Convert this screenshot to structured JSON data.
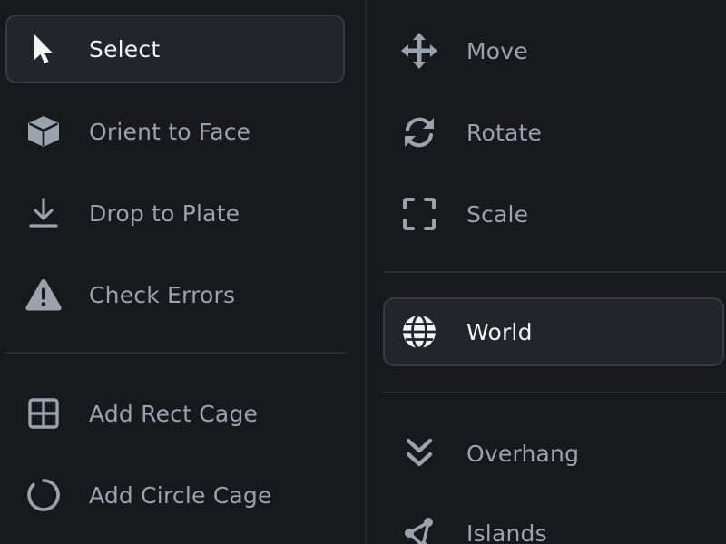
{
  "left_panel": {
    "items": [
      {
        "label": "Select",
        "icon": "cursor-arrow-icon",
        "active": true
      },
      {
        "label": "Orient to Face",
        "icon": "cube-icon",
        "active": false
      },
      {
        "label": "Drop to Plate",
        "icon": "download-arrow-icon",
        "active": false
      },
      {
        "label": "Check Errors",
        "icon": "warning-triangle-icon",
        "active": false
      },
      {
        "label": "Add Rect Cage",
        "icon": "grid-square-icon",
        "active": false
      },
      {
        "label": "Add Circle Cage",
        "icon": "circle-ring-icon",
        "active": false
      }
    ]
  },
  "right_panel": {
    "items": [
      {
        "label": "Move",
        "icon": "move-arrows-icon",
        "active": false
      },
      {
        "label": "Rotate",
        "icon": "rotate-icon",
        "active": false
      },
      {
        "label": "Scale",
        "icon": "scale-corners-icon",
        "active": false
      },
      {
        "label": "World",
        "icon": "globe-icon",
        "active": true
      },
      {
        "label": "Overhang",
        "icon": "double-chevron-down-icon",
        "active": false
      },
      {
        "label": "Islands",
        "icon": "islands-nodes-icon",
        "active": false
      }
    ]
  },
  "colors": {
    "background": "#17191d",
    "text": "#9aa3ad",
    "active_text": "#f1f3f5",
    "active_bg": "#22252a",
    "active_border": "#363a41",
    "divider": "#2a2d33"
  }
}
